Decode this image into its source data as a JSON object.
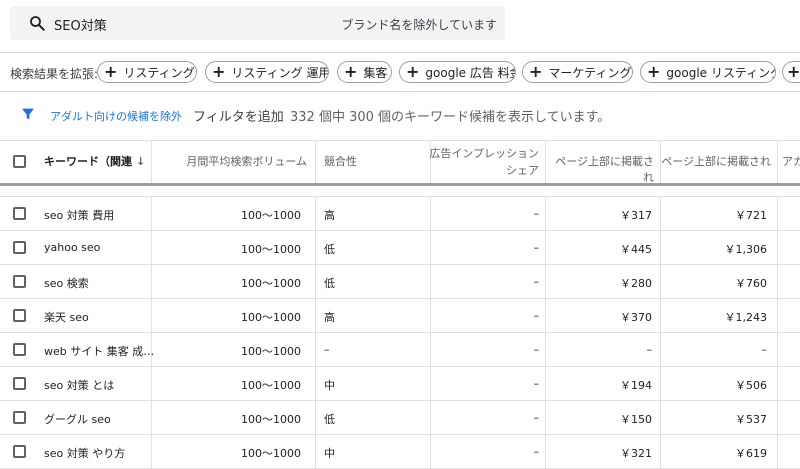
{
  "search": {
    "query": "SEO対策",
    "exclude_brand": "ブランド名を除外しています"
  },
  "expand": {
    "label": "検索結果を拡張:",
    "chips": [
      "リスティング",
      "リスティング 運用",
      "集客",
      "google 広告 料金",
      "マーケティング",
      "google リスティング",
      ""
    ]
  },
  "filters": {
    "exclude_adult": "アダルト向けの候補を除外",
    "add_filter": "フィルタを追加",
    "result_count": "332 個中 300 個のキーワード候補を表示しています。"
  },
  "table": {
    "headers": {
      "keyword": "キーワード（関連",
      "monthly": "月間平均検索ボリューム",
      "competition": "競合性",
      "impression_share_line1": "広告インプレッション",
      "impression_share_line2": "シェア",
      "top_bid_low": "ページ上部に掲載され",
      "top_bid_high": "ページ上部に掲載され",
      "account": "アカ"
    },
    "rows": [
      {
        "keyword": "seo 対策 費用",
        "monthly": "100～1000",
        "competition": "高",
        "share": "–",
        "low": "￥317",
        "high": "￥721"
      },
      {
        "keyword": "yahoo seo",
        "monthly": "100～1000",
        "competition": "低",
        "share": "–",
        "low": "￥445",
        "high": "￥1,306"
      },
      {
        "keyword": "seo 検索",
        "monthly": "100～1000",
        "competition": "低",
        "share": "–",
        "low": "￥280",
        "high": "￥760"
      },
      {
        "keyword": "楽天 seo",
        "monthly": "100～1000",
        "competition": "高",
        "share": "–",
        "low": "￥370",
        "high": "￥1,243"
      },
      {
        "keyword": "web サイト 集客 成…",
        "monthly": "100～1000",
        "competition": "–",
        "share": "–",
        "low": "–",
        "high": "–"
      },
      {
        "keyword": "seo 対策 とは",
        "monthly": "100～1000",
        "competition": "中",
        "share": "–",
        "low": "￥194",
        "high": "￥506"
      },
      {
        "keyword": "グーグル seo",
        "monthly": "100～1000",
        "competition": "低",
        "share": "–",
        "low": "￥150",
        "high": "￥537"
      },
      {
        "keyword": "seo 対策 やり方",
        "monthly": "100～1000",
        "competition": "中",
        "share": "–",
        "low": "￥321",
        "high": "￥619"
      }
    ]
  },
  "icons": {
    "search": "search-icon",
    "filter": "filter-icon",
    "sort": "arrow-down-icon",
    "chip_add": "plus-icon"
  },
  "colors": {
    "accent": "#1a73e8",
    "search_bg": "#f1f3f4"
  }
}
